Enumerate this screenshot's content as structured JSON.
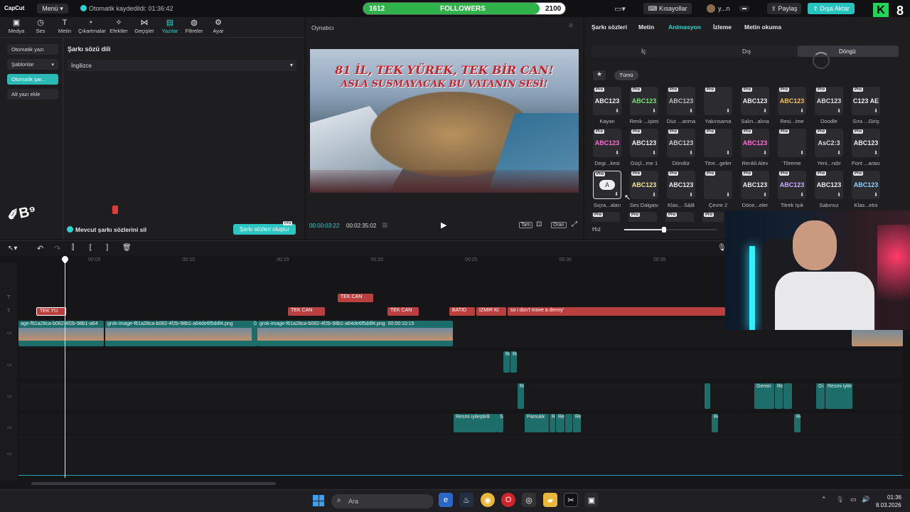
{
  "app": {
    "logo": "CapCut",
    "menu": "Menü",
    "autosave": "Otomatik kaydedildi: 01:36:42",
    "shortcuts": "Kısayollar",
    "user": "y...n",
    "share": "Paylaş",
    "export": "Dışa Aktar"
  },
  "overlay": {
    "followers_current": "1612",
    "followers_label": "FOLLOWERS",
    "followers_goal": "2100",
    "channel_badge": "8"
  },
  "toolbar": [
    {
      "label": "Medya",
      "icon": "media-icon"
    },
    {
      "label": "Ses",
      "icon": "audio-icon"
    },
    {
      "label": "Metin",
      "icon": "text-icon"
    },
    {
      "label": "Çıkartmalar",
      "icon": "sticker-icon"
    },
    {
      "label": "Efektler",
      "icon": "effects-icon"
    },
    {
      "label": "Geçişler",
      "icon": "transitions-icon"
    },
    {
      "label": "Yazılar",
      "icon": "captions-icon"
    },
    {
      "label": "Filtreler",
      "icon": "filters-icon"
    },
    {
      "label": "Ayar",
      "icon": "adjust-icon"
    }
  ],
  "sidebar": [
    "Otomatik yazı",
    "Şablonlar",
    "Otomatik şar...",
    "Alt yazı ekle"
  ],
  "lyrics": {
    "title": "Şarkı sözü dili",
    "language": "İngilizce",
    "delete_label": "Mevcut şarkı sözlerini sil",
    "generate": "Şarkı sözleri oluştur",
    "pro": "Pro"
  },
  "player": {
    "title": "Oynatıcı",
    "headline1": "81 İL, TEK YÜREK, TEK BİR CAN!",
    "headline2": "ASLA SUSMAYACAK BU VATANIN SESİ!",
    "current": "00:00:03:22",
    "total": "00:02:35:02",
    "full": "Tam",
    "ratio": "Oran"
  },
  "inspector": {
    "tabs": [
      "Şarkı sözleri",
      "Metin",
      "Animasyon",
      "İzleme",
      "Metin okuma"
    ],
    "subtabs": [
      "İç",
      "Dış",
      "Döngü"
    ],
    "filter_all": "Tümü",
    "speed": "Hız"
  },
  "animations": [
    {
      "text": "ABC123",
      "label": "Kayan"
    },
    {
      "text": "ABC123",
      "label": "Renk ...işimi"
    },
    {
      "text": "ABC123",
      "label": "Düz ...anma"
    },
    {
      "text": "",
      "label": "Yakınsama"
    },
    {
      "text": "ABC123",
      "label": "Salın...alına"
    },
    {
      "text": "ABC123",
      "label": "Resi...ime"
    },
    {
      "text": "ABC123",
      "label": "Doodle"
    },
    {
      "text": "C123 AE",
      "label": "Sıra ...Giriş"
    },
    {
      "text": "ABC123",
      "label": "Degr...kesi"
    },
    {
      "text": "ABC123",
      "label": "Güçl...me 1"
    },
    {
      "text": "ABC123",
      "label": "Döndür"
    },
    {
      "text": "",
      "label": "Titre...geler"
    },
    {
      "text": "ABC123",
      "label": "Renkli Alev"
    },
    {
      "text": "",
      "label": "Titreme"
    },
    {
      "text": "AsC2:3",
      "label": "Yeni...ndır"
    },
    {
      "text": "ABC123",
      "label": "Font ...arası"
    },
    {
      "text": "A",
      "label": "Sıçra...aları"
    },
    {
      "text": "ABC123",
      "label": "Ses Dalgası"
    },
    {
      "text": "ABC123",
      "label": "Klas... S&B"
    },
    {
      "text": "",
      "label": "Çevre 2"
    },
    {
      "text": "ABC123",
      "label": "Döne...eler"
    },
    {
      "text": "ABC123",
      "label": "Titrek Işık"
    },
    {
      "text": "ABC123",
      "label": "Sabırsız"
    },
    {
      "text": "ABC123",
      "label": "Klas...etni"
    }
  ],
  "timeline": {
    "ticks": [
      "00:05",
      "00:10",
      "00:15",
      "00:20",
      "00:25",
      "00:30",
      "00:35"
    ],
    "text_clips": [
      "TEK CAN",
      "TEK YÜ",
      "TEK CAN",
      "TEK CAN",
      "BATID",
      "İZMİR Kİ",
      "so i don't move a denny'"
    ],
    "video_clips": [
      "age-f61a28ca-b082-4f2b-98b1-a64",
      "grok-image-f61a28ca-b082-4f2b-98b1-a64de6f5ddf4.png",
      "0",
      "grok-image-f61a28ca-b082-4f2b-98b1-a64de6f5ddf4.png",
      "00:00:10:15"
    ],
    "small_clips": [
      "Re",
      "Re",
      "Re",
      "Gemin",
      "Re",
      "Gi",
      "Resmi iyile",
      "Resmi iyileştirili",
      "Sl",
      "Pamukk",
      "R",
      "Re",
      "Re",
      "Re",
      "Re"
    ]
  },
  "taskbar": {
    "search": "Ara",
    "time": "01:36",
    "date": "8.03.2026"
  }
}
